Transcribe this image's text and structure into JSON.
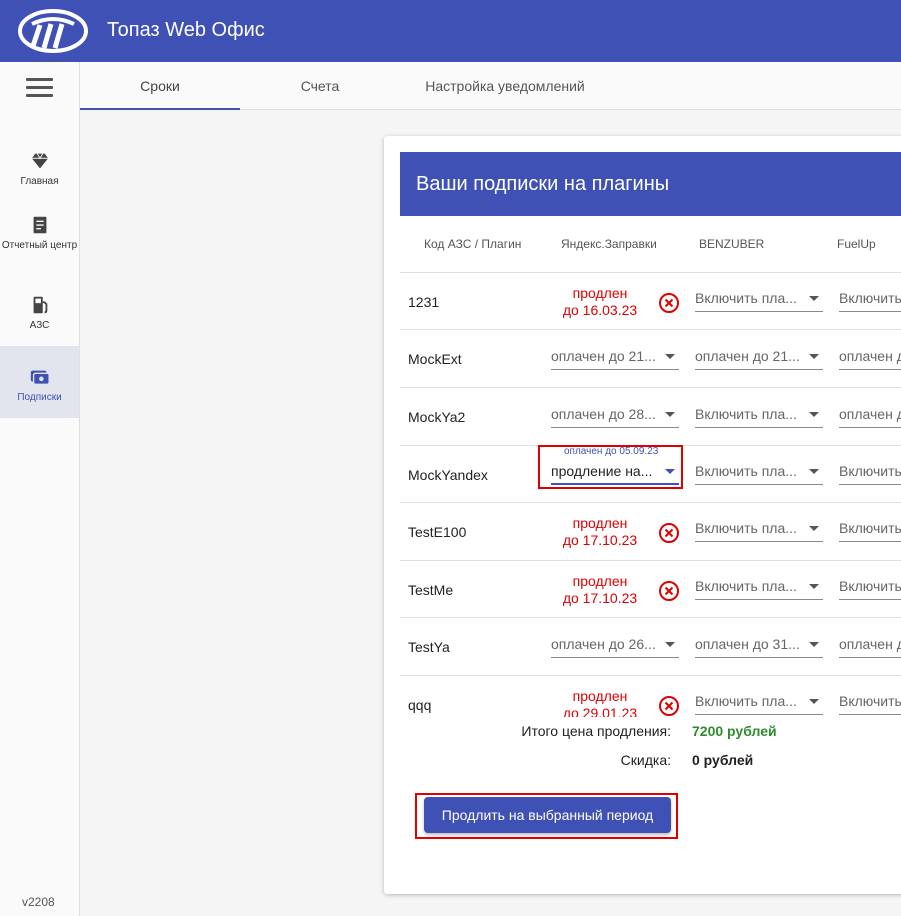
{
  "app": {
    "title": "Топаз Web Офис"
  },
  "sidebar": {
    "items": [
      {
        "label": "Главная",
        "icon": "diamond-icon"
      },
      {
        "label": "Отчетный центр",
        "icon": "report-icon"
      },
      {
        "label": "АЗС",
        "icon": "fuel-pump-icon"
      },
      {
        "label": "Подписки",
        "icon": "subscriptions-icon"
      }
    ],
    "version": "v2208"
  },
  "tabs": [
    {
      "label": "Сроки"
    },
    {
      "label": "Счета"
    },
    {
      "label": "Настройка уведомлений"
    }
  ],
  "card": {
    "title": "Ваши подписки на плагины",
    "columns": [
      "Код АЗС / Плагин",
      "Яндекс.Заправки",
      "BENZUBER",
      "FuelUp"
    ],
    "rows": [
      {
        "name": "1231",
        "yandex": {
          "type": "extended",
          "l1": "продлен",
          "l2": "до 16.03.23"
        },
        "benz": "Включить пла...",
        "fuel": "Включить"
      },
      {
        "name": "MockExt",
        "yandex": {
          "type": "select",
          "value": "оплачен до 21..."
        },
        "benz": "оплачен до 21...",
        "fuel": "оплачен д"
      },
      {
        "name": "MockYa2",
        "yandex": {
          "type": "select",
          "value": "оплачен до 28..."
        },
        "benz": "Включить пла...",
        "fuel": "оплачен д"
      },
      {
        "name": "MockYandex",
        "yandex": {
          "type": "focus",
          "float": "оплачен до 05.09.23",
          "value": "продление на..."
        },
        "benz": "Включить пла...",
        "fuel": "Включить"
      },
      {
        "name": "TestE100",
        "yandex": {
          "type": "extended",
          "l1": "продлен",
          "l2": "до 17.10.23"
        },
        "benz": "Включить пла...",
        "fuel": "Включить"
      },
      {
        "name": "TestMe",
        "yandex": {
          "type": "extended",
          "l1": "продлен",
          "l2": "до 17.10.23"
        },
        "benz": "Включить пла...",
        "fuel": "Включить"
      },
      {
        "name": "TestYa",
        "yandex": {
          "type": "select",
          "value": "оплачен до 26..."
        },
        "benz": "оплачен до 31...",
        "fuel": "оплачен д"
      },
      {
        "name": "qqq",
        "yandex": {
          "type": "extended",
          "l1": "продлен",
          "l2": "до 29.01.23"
        },
        "benz": "Включить пла...",
        "fuel": "Включить"
      }
    ],
    "total_label": "Итого цена продления:",
    "total_value": "7200 рублей",
    "total_color": "#2e8b2e",
    "discount_label": "Скидка:",
    "discount_value": "0 рублей",
    "extend_button": "Продлить на выбранный период"
  },
  "colors": {
    "primary": "#3f51b5",
    "highlight": "#e00000"
  }
}
